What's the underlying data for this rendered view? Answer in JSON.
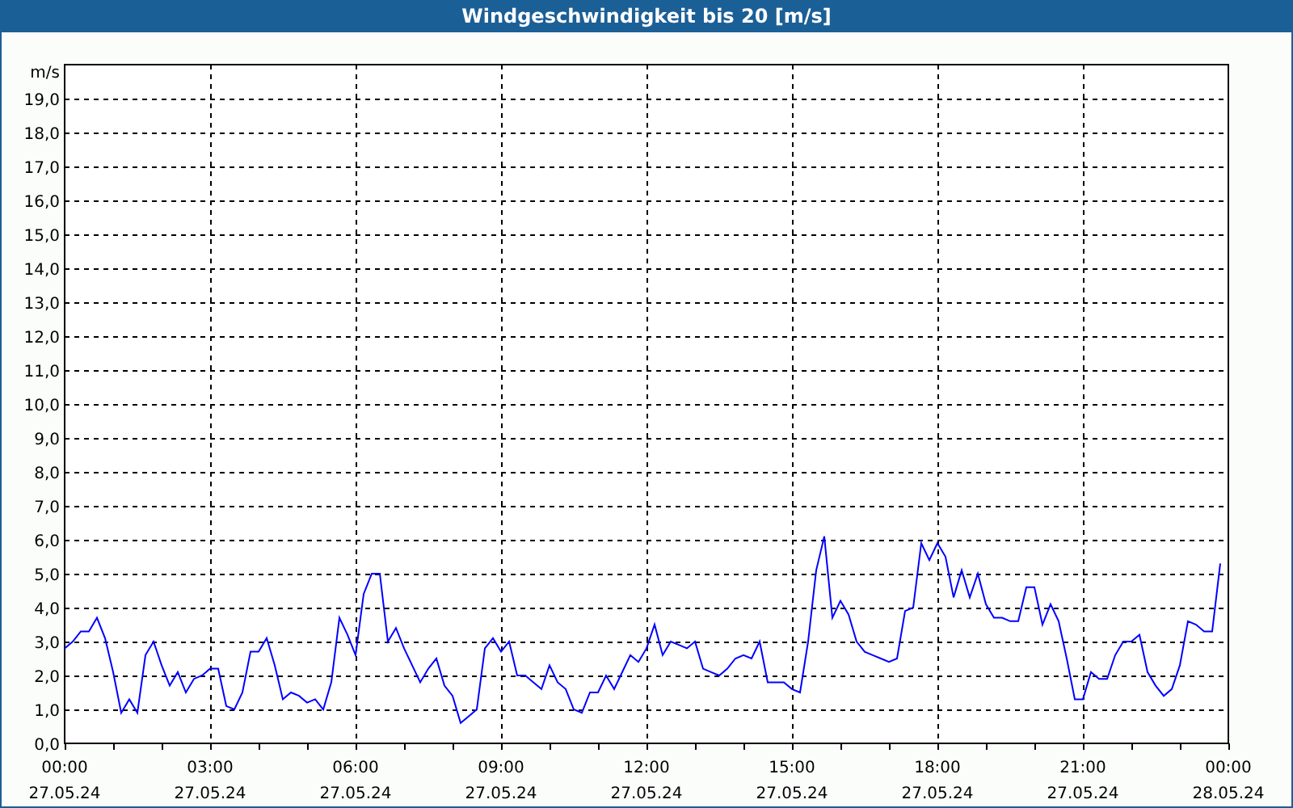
{
  "window": {
    "title": "Windgeschwindigkeit bis 20 [m/s]"
  },
  "x_axis_dates": [
    "27.05.24",
    "27.05.24",
    "27.05.24",
    "27.05.24",
    "27.05.24",
    "27.05.24",
    "27.05.24",
    "27.05.24"
  ],
  "chart_data": {
    "type": "line",
    "grid": true,
    "ylabel": "m/s",
    "xlim": [
      0,
      1440
    ],
    "ylim": [
      0,
      20
    ],
    "x": [
      0,
      10,
      20,
      30,
      40,
      50,
      60,
      70,
      80,
      90,
      100,
      110,
      120,
      130,
      140,
      150,
      160,
      170,
      180,
      190,
      200,
      210,
      220,
      230,
      240,
      250,
      260,
      270,
      280,
      290,
      300,
      310,
      320,
      330,
      340,
      350,
      360,
      370,
      380,
      390,
      400,
      410,
      420,
      430,
      440,
      450,
      460,
      470,
      480,
      490,
      500,
      510,
      520,
      530,
      540,
      550,
      560,
      570,
      580,
      590,
      600,
      610,
      620,
      630,
      640,
      650,
      660,
      670,
      680,
      690,
      700,
      710,
      720,
      730,
      740,
      750,
      760,
      770,
      780,
      790,
      800,
      810,
      820,
      830,
      840,
      850,
      860,
      870,
      880,
      890,
      900,
      910,
      920,
      930,
      940,
      950,
      960,
      970,
      980,
      990,
      1000,
      1010,
      1020,
      1030,
      1040,
      1050,
      1060,
      1070,
      1080,
      1090,
      1100,
      1110,
      1120,
      1130,
      1140,
      1150,
      1160,
      1170,
      1180,
      1190,
      1200,
      1210,
      1220,
      1230,
      1240,
      1250,
      1260,
      1270,
      1280,
      1290,
      1300,
      1310,
      1320,
      1330,
      1340,
      1350,
      1360,
      1370,
      1380,
      1390,
      1400,
      1410,
      1420,
      1430
    ],
    "series": [
      {
        "color": "#0000ff",
        "values": [
          2.8,
          3.0,
          3.3,
          3.3,
          3.7,
          3.1,
          2.1,
          0.9,
          1.3,
          0.9,
          2.6,
          3.0,
          2.3,
          1.7,
          2.1,
          1.5,
          1.9,
          2.0,
          2.2,
          2.2,
          1.1,
          1.0,
          1.5,
          2.7,
          2.7,
          3.1,
          2.3,
          1.3,
          1.5,
          1.4,
          1.2,
          1.3,
          1.0,
          1.8,
          3.7,
          3.2,
          2.6,
          4.4,
          5.0,
          5.0,
          3.0,
          3.4,
          2.8,
          2.3,
          1.8,
          2.2,
          2.5,
          1.7,
          1.4,
          0.6,
          0.8,
          1.0,
          2.8,
          3.1,
          2.7,
          3.0,
          2.0,
          2.0,
          1.8,
          1.6,
          2.3,
          1.8,
          1.6,
          1.0,
          0.9,
          1.5,
          1.5,
          2.0,
          1.6,
          2.1,
          2.6,
          2.4,
          2.8,
          3.5,
          2.6,
          3.0,
          2.9,
          2.8,
          3.0,
          2.2,
          2.1,
          2.0,
          2.2,
          2.5,
          2.6,
          2.5,
          3.0,
          1.8,
          1.8,
          1.8,
          1.6,
          1.5,
          3.0,
          5.1,
          6.1,
          3.7,
          4.2,
          3.8,
          3.0,
          2.7,
          2.6,
          2.5,
          2.4,
          2.5,
          3.9,
          4.0,
          5.9,
          5.4,
          5.9,
          5.5,
          4.3,
          5.1,
          4.3,
          5.0,
          4.1,
          3.7,
          3.7,
          3.6,
          3.6,
          4.6,
          4.6,
          3.5,
          4.1,
          3.6,
          2.5,
          1.3,
          1.3,
          2.1,
          1.9,
          1.9,
          2.6,
          3.0,
          3.0,
          3.2,
          2.1,
          1.7,
          1.4,
          1.6,
          2.3,
          3.6,
          3.5,
          3.3,
          3.3,
          5.3
        ]
      }
    ],
    "xticks": [
      {
        "value": 0,
        "label": "00:00"
      },
      {
        "value": 180,
        "label": "03:00"
      },
      {
        "value": 360,
        "label": "06:00"
      },
      {
        "value": 540,
        "label": "09:00"
      },
      {
        "value": 720,
        "label": "12:00"
      },
      {
        "value": 900,
        "label": "15:00"
      },
      {
        "value": 1080,
        "label": "18:00"
      },
      {
        "value": 1260,
        "label": "21:00"
      },
      {
        "value": 1440,
        "label": "00:00\n28.05.24"
      }
    ],
    "yticks": [
      {
        "value": 0,
        "label": "0,0"
      },
      {
        "value": 1,
        "label": "1,0"
      },
      {
        "value": 2,
        "label": "2,0"
      },
      {
        "value": 3,
        "label": "3,0"
      },
      {
        "value": 4,
        "label": "4,0"
      },
      {
        "value": 5,
        "label": "5,0"
      },
      {
        "value": 6,
        "label": "6,0"
      },
      {
        "value": 7,
        "label": "7,0"
      },
      {
        "value": 8,
        "label": "8,0"
      },
      {
        "value": 9,
        "label": "9,0"
      },
      {
        "value": 10,
        "label": "10,0"
      },
      {
        "value": 11,
        "label": "11,0"
      },
      {
        "value": 12,
        "label": "12,0"
      },
      {
        "value": 13,
        "label": "13,0"
      },
      {
        "value": 14,
        "label": "14,0"
      },
      {
        "value": 15,
        "label": "15,0"
      },
      {
        "value": 16,
        "label": "16,0"
      },
      {
        "value": 17,
        "label": "17,0"
      },
      {
        "value": 18,
        "label": "18,0"
      },
      {
        "value": 19,
        "label": "19,0"
      }
    ]
  }
}
